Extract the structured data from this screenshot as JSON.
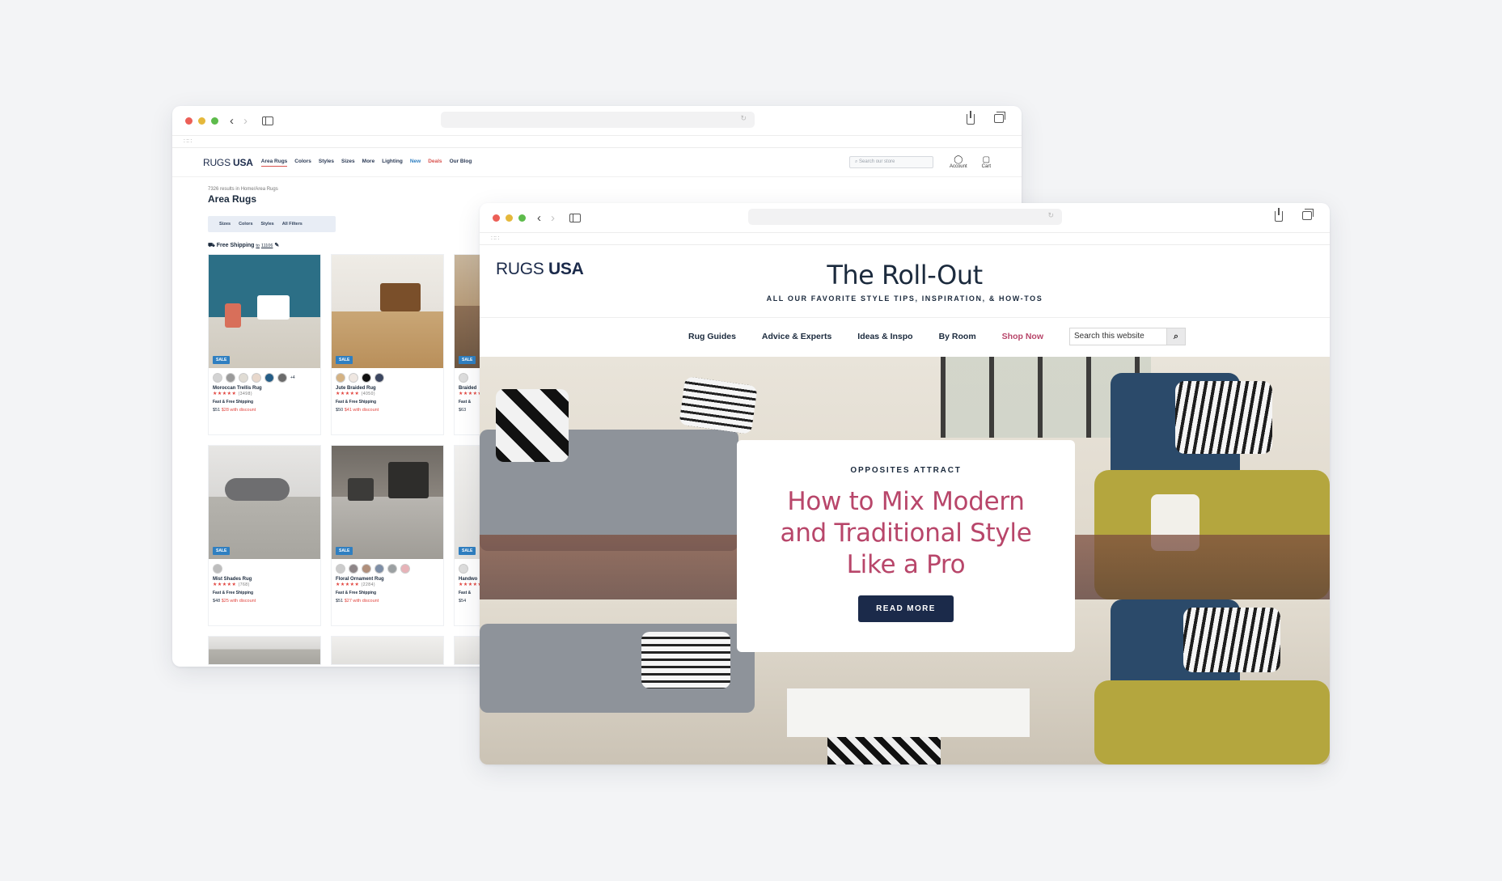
{
  "colors": {
    "navy": "#1b2a4a",
    "accent_pink": "#b8466a",
    "sale_blue": "#2f7fc1",
    "star_red": "#e1453f"
  },
  "shop": {
    "logo_part1": "RUGS",
    "logo_part2": "USA",
    "nav": [
      "Area Rugs",
      "Colors",
      "Styles",
      "Sizes",
      "More",
      "Lighting",
      "New",
      "Deals",
      "Our Blog"
    ],
    "search_placeholder": "Search our store",
    "account_label": "Account",
    "cart_label": "Cart",
    "breadcrumb": "7326 results in Home/Area Rugs",
    "title": "Area Rugs",
    "filters": [
      "Sizes",
      "Colors",
      "Styles",
      "All Filters"
    ],
    "free_shipping": "Free Shipping",
    "free_shipping_to": "to",
    "zip": "11106",
    "products": [
      {
        "badge": "SALE",
        "name": "Moroccan Trellis Rug",
        "reviews": "(3498)",
        "shipping": "Fast & Free Shipping",
        "price": "$51",
        "discount": "$28 with discount",
        "more_colors": "+4"
      },
      {
        "badge": "SALE",
        "name": "Jute Braided Rug",
        "reviews": "(4050)",
        "shipping": "Fast & Free Shipping",
        "price": "$50",
        "discount": "$41 with discount"
      },
      {
        "badge": "SALE",
        "name": "Braided",
        "reviews": "",
        "shipping": "Fast &",
        "price": "$63"
      },
      {
        "badge": "SALE",
        "name": "Mist Shades Rug",
        "reviews": "(768)",
        "shipping": "Fast & Free Shipping",
        "price": "$48",
        "discount": "$25 with discount"
      },
      {
        "badge": "SALE",
        "name": "Floral Ornament Rug",
        "reviews": "(2284)",
        "shipping": "Fast & Free Shipping",
        "price": "$51",
        "discount": "$27 with discount"
      },
      {
        "badge": "SALE",
        "name": "Handwo",
        "reviews": "",
        "shipping": "Fast &",
        "price": "$54"
      }
    ]
  },
  "blog": {
    "logo_part1": "RUGS",
    "logo_part2": "USA",
    "title": "The Roll-Out",
    "tagline": "ALL OUR FAVORITE STYLE TIPS, INSPIRATION, & HOW-TOS",
    "nav": [
      "Rug Guides",
      "Advice & Experts",
      "Ideas & Inspo",
      "By Room",
      "Shop Now"
    ],
    "search_placeholder": "Search this website",
    "hero": {
      "kicker": "OPPOSITES ATTRACT",
      "headline": "How to Mix Modern and Traditional Style Like a Pro",
      "cta": "READ MORE"
    }
  }
}
